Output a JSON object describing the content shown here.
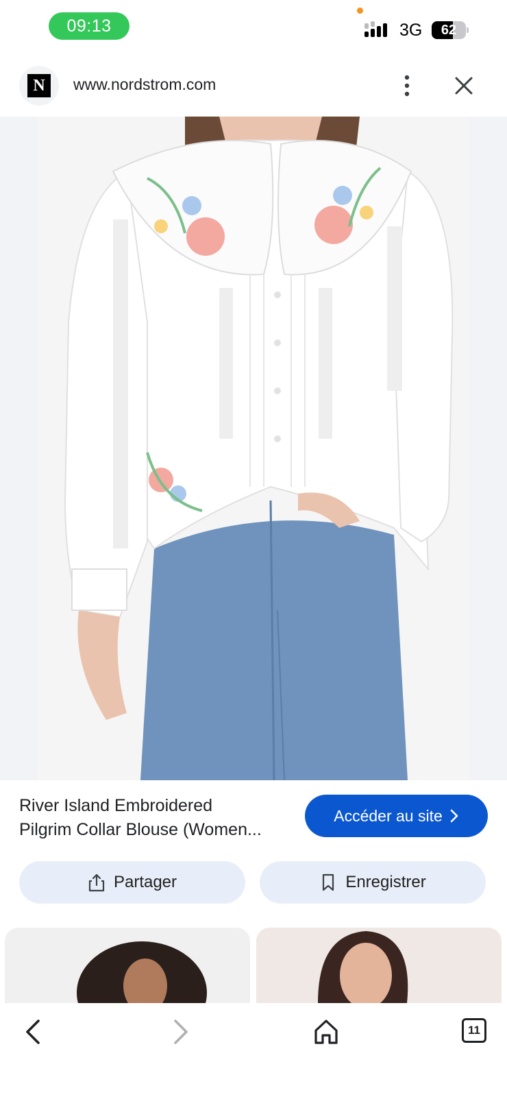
{
  "status": {
    "time": "09:13",
    "network": "3G",
    "battery": "62",
    "battery_level": 0.62
  },
  "browser": {
    "site_initial": "N",
    "url": "www.nordstrom.com"
  },
  "product": {
    "title_line1": "River Island Embroidered",
    "title_line2": "Pilgrim Collar Blouse (Women..."
  },
  "actions": {
    "visit_label": "Accéder au site",
    "share_label": "Partager",
    "save_label": "Enregistrer"
  },
  "nav": {
    "tab_count": "11"
  },
  "colors": {
    "accent": "#0b57d0",
    "chip_bg": "#e8eef9",
    "time_pill": "#34c759"
  }
}
